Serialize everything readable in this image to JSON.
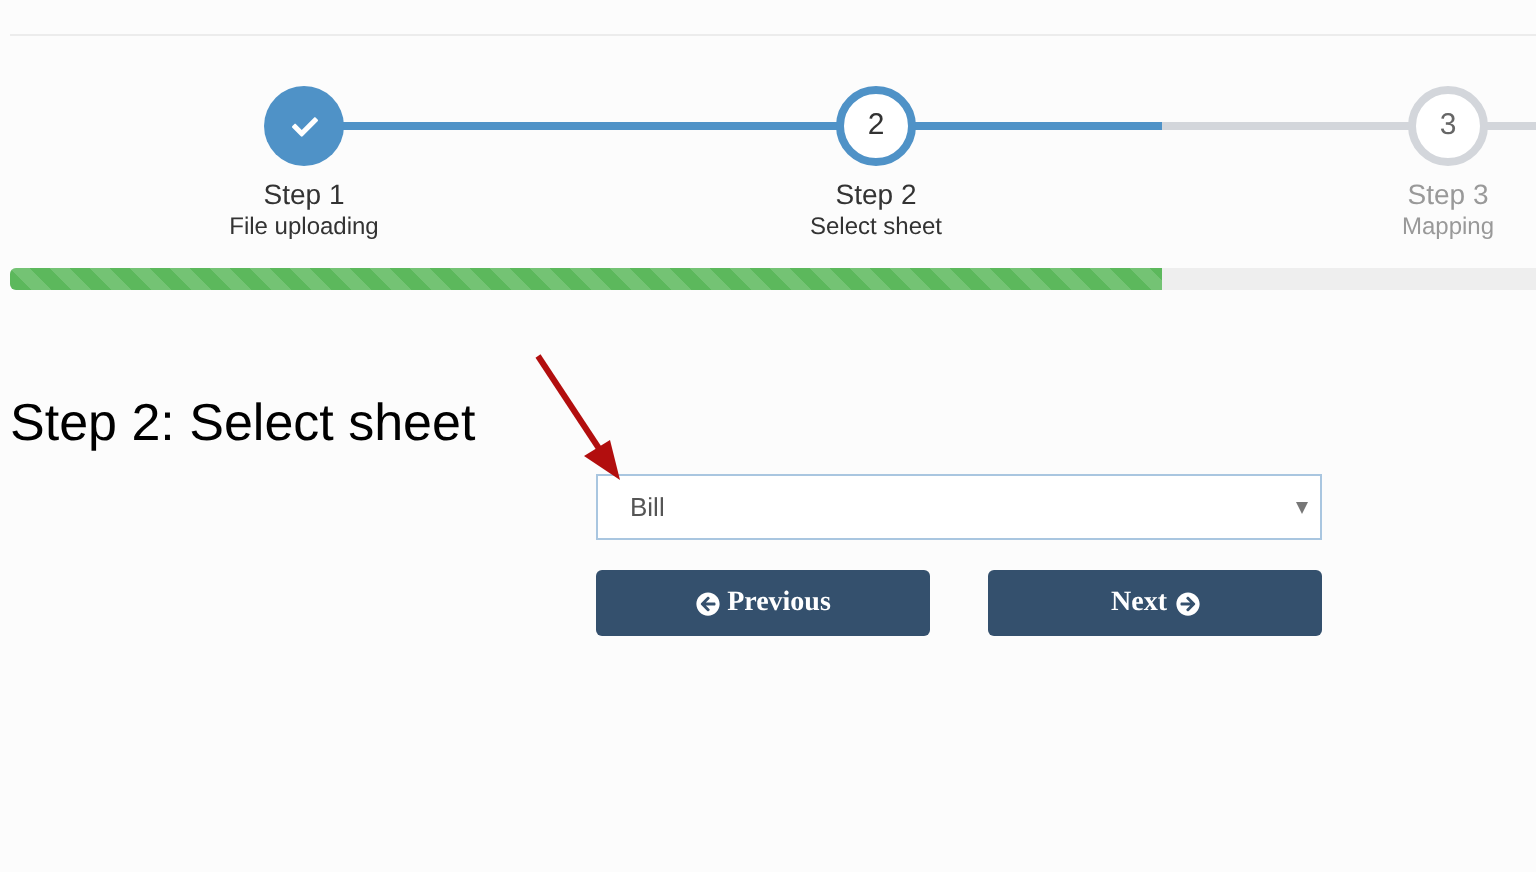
{
  "steps": [
    {
      "title": "Step 1",
      "subtitle": "File uploading",
      "completed": true,
      "selected": false
    },
    {
      "title": "Step 2",
      "subtitle": "Select sheet",
      "completed": false,
      "selected": true,
      "number": "2"
    },
    {
      "title": "Step 3",
      "subtitle": "Mapping",
      "completed": false,
      "selected": false,
      "number": "3"
    }
  ],
  "progress": {
    "level": 0.755
  },
  "heading": "Step 2: Select sheet",
  "sheet_select": {
    "value": "Bill"
  },
  "buttons": [
    {
      "label": "Previous",
      "kind": "previous"
    },
    {
      "label": "Next",
      "kind": "next"
    }
  ]
}
